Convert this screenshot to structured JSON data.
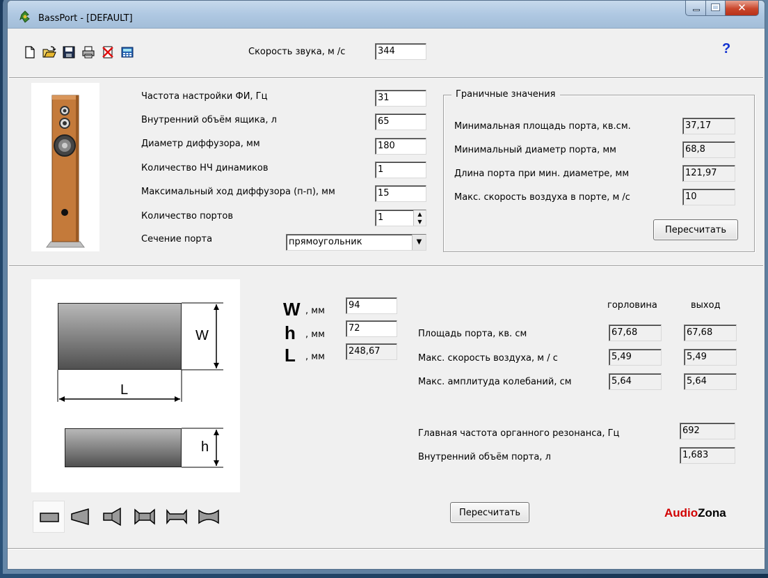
{
  "window": {
    "title": "BassPort - [DEFAULT]"
  },
  "toolbar": {
    "icons": [
      "new-file-icon",
      "open-folder-icon",
      "save-disk-icon",
      "print-icon",
      "delete-icon",
      "calculator-icon",
      "help-icon"
    ],
    "sound_speed_label": "Скорость звука, м /с",
    "sound_speed_value": "344",
    "help_label": "?"
  },
  "inputs": {
    "tuning_freq_label": "Частота настройки ФИ, Гц",
    "tuning_freq_value": "31",
    "volume_label": "Внутренний объём ящика, л",
    "volume_value": "65",
    "cone_diameter_label": "Диаметр диффузора, мм",
    "cone_diameter_value": "180",
    "woofers_label": "Количество НЧ динамиков",
    "woofers_value": "1",
    "excursion_label": "Максимальный ход диффузора (п-п), мм",
    "excursion_value": "15",
    "ports_label": "Количество портов",
    "ports_value": "1",
    "section_label": "Сечение порта",
    "section_value": "прямоугольник"
  },
  "limits": {
    "title": "Граничные значения",
    "min_area_label": "Минимальная площадь порта, кв.см.",
    "min_area_value": "37,17",
    "min_diameter_label": "Минимальный диаметр порта, мм",
    "min_diameter_value": "68,8",
    "port_length_label": "Длина порта при мин. диаметре, мм",
    "port_length_value": "121,97",
    "max_air_speed_label": "Макс. скорость воздуха в порте, м /с",
    "max_air_speed_value": "10",
    "recalc_label": "Пересчитать"
  },
  "diagram": {
    "w_label": "W",
    "l_label": "L",
    "h_label": "h"
  },
  "dimensions": {
    "w_big": "W",
    "w_unit": ", мм",
    "w_value": "94",
    "h_big": "h",
    "h_unit": ", мм",
    "h_value": "72",
    "l_big": "L",
    "l_unit": ", мм",
    "l_value": "248,67"
  },
  "results": {
    "throat_header": "горловина",
    "exit_header": "выход",
    "area_label": "Площадь порта, кв. см",
    "area_throat": "67,68",
    "area_exit": "67,68",
    "air_speed_label": "Макс. скорость воздуха, м / с",
    "air_speed_throat": "5,49",
    "air_speed_exit": "5,49",
    "amplitude_label": "Макс. амплитуда колебаний, см",
    "amplitude_throat": "5,64",
    "amplitude_exit": "5,64",
    "organ_res_label": "Главная частота органного резонанса, Гц",
    "organ_res_value": "692",
    "port_volume_label": "Внутренний объём порта, л",
    "port_volume_value": "1,683",
    "recalc_label": "Пересчитать"
  },
  "shapes": [
    "rect-port-shape-icon",
    "cone-port-shape-icon",
    "horn-port-shape-icon",
    "flared-port-shape-icon",
    "double-flare-port-shape-icon",
    "hourglass-port-shape-icon"
  ],
  "brand": {
    "audio": "Audio",
    "zona": "Zona"
  },
  "colors": {
    "brand_red": "#d20000",
    "help_blue": "#1030d0",
    "speaker_wood": "#c47a3a"
  }
}
